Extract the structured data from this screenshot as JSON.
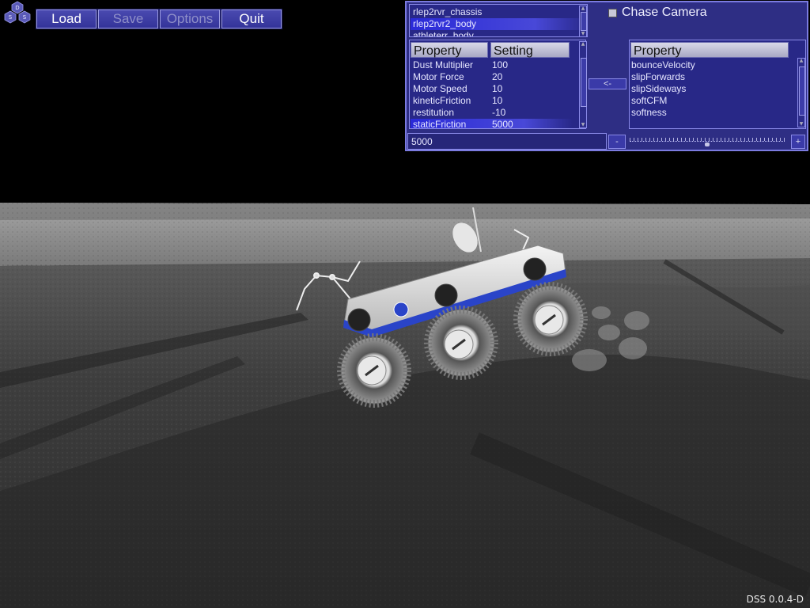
{
  "toolbar": {
    "load": "Load",
    "save": "Save",
    "options": "Options",
    "quit": "Quit"
  },
  "logo_letters": [
    "D",
    "S",
    "S"
  ],
  "object_list": {
    "items": [
      "rlep2rvr_chassis",
      "rlep2rvr2_body",
      "athleterr_body"
    ],
    "selected_index": 1
  },
  "chase_camera": {
    "label": "Chase Camera",
    "checked": false
  },
  "settings_table": {
    "header_property": "Property",
    "header_setting": "Setting",
    "rows": [
      {
        "property": "Dust Multiplier",
        "setting": "100"
      },
      {
        "property": "Motor Force",
        "setting": "20"
      },
      {
        "property": "Motor Speed",
        "setting": "10"
      },
      {
        "property": "kineticFriction",
        "setting": "10"
      },
      {
        "property": "restitution",
        "setting": "-10"
      },
      {
        "property": "staticFriction",
        "setting": "5000"
      }
    ],
    "selected_index": 5
  },
  "move_button": "<-",
  "available_props": {
    "header": "Property",
    "items": [
      "bounceVelocity",
      "slipForwards",
      "slipSideways",
      "softCFM",
      "softness"
    ]
  },
  "value_field": {
    "value": "5000"
  },
  "minus_button": "-",
  "plus_button": "+",
  "slider": {
    "value_fraction": 0.5
  },
  "version": "DSS 0.0.4-D",
  "colors": {
    "panel": "#3434a0",
    "selection": "#2a2ad8",
    "rover_accent": "#2a44c8"
  }
}
